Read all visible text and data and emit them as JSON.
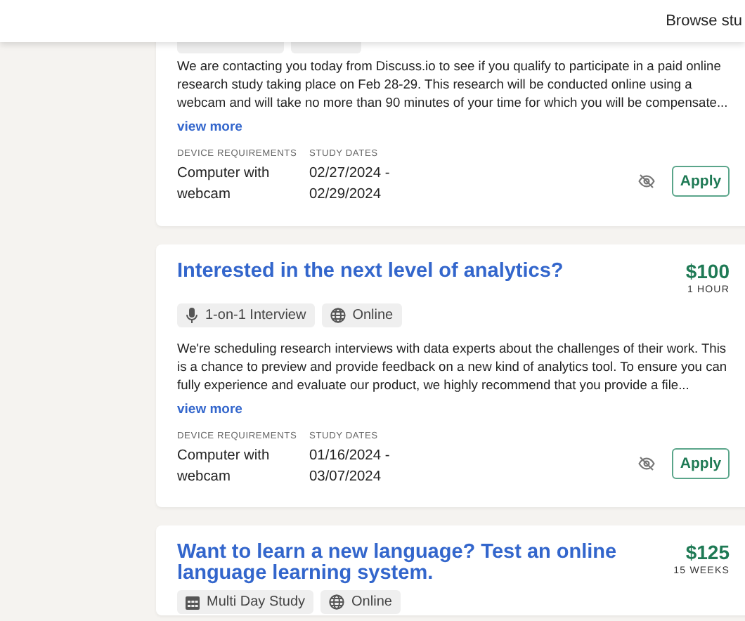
{
  "header": {
    "link": "Browse stu"
  },
  "studies": [
    {
      "kind": "cut",
      "description": "We are contacting you today from Discuss.io to see if you qualify to participate in a paid online research study taking place on Feb 28-29. This research will be conducted online using a webcam and will take no more than 90 minutes of your time for which you will be compensate...",
      "view_more": "view more",
      "device_label": "DEVICE REQUIREMENTS",
      "device": "Computer with webcam",
      "dates_label": "STUDY DATES",
      "dates": "02/27/2024 - 02/29/2024",
      "apply": "Apply"
    },
    {
      "kind": "full",
      "title": "Interested in the next level of analytics?",
      "price": "$100",
      "duration": "1 HOUR",
      "tags": [
        {
          "kind": "interview",
          "label": "1-on-1 Interview"
        },
        {
          "kind": "online",
          "label": "Online"
        }
      ],
      "description": "We're scheduling research interviews with data experts about the challenges of their work. This is a chance to preview and provide feedback on a new kind of analytics tool. To ensure you can fully experience and evaluate our product, we highly recommend that you provide a file...",
      "view_more": "view more",
      "device_label": "DEVICE REQUIREMENTS",
      "device": "Computer with webcam",
      "dates_label": "STUDY DATES",
      "dates": "01/16/2024 - 03/07/2024",
      "apply": "Apply"
    },
    {
      "kind": "full",
      "title": "Want to learn a new language? Test an online language learning system.",
      "price": "$125",
      "duration": "15 WEEKS",
      "tags": [
        {
          "kind": "multiday",
          "label": "Multi Day Study"
        },
        {
          "kind": "online",
          "label": "Online"
        }
      ]
    }
  ]
}
